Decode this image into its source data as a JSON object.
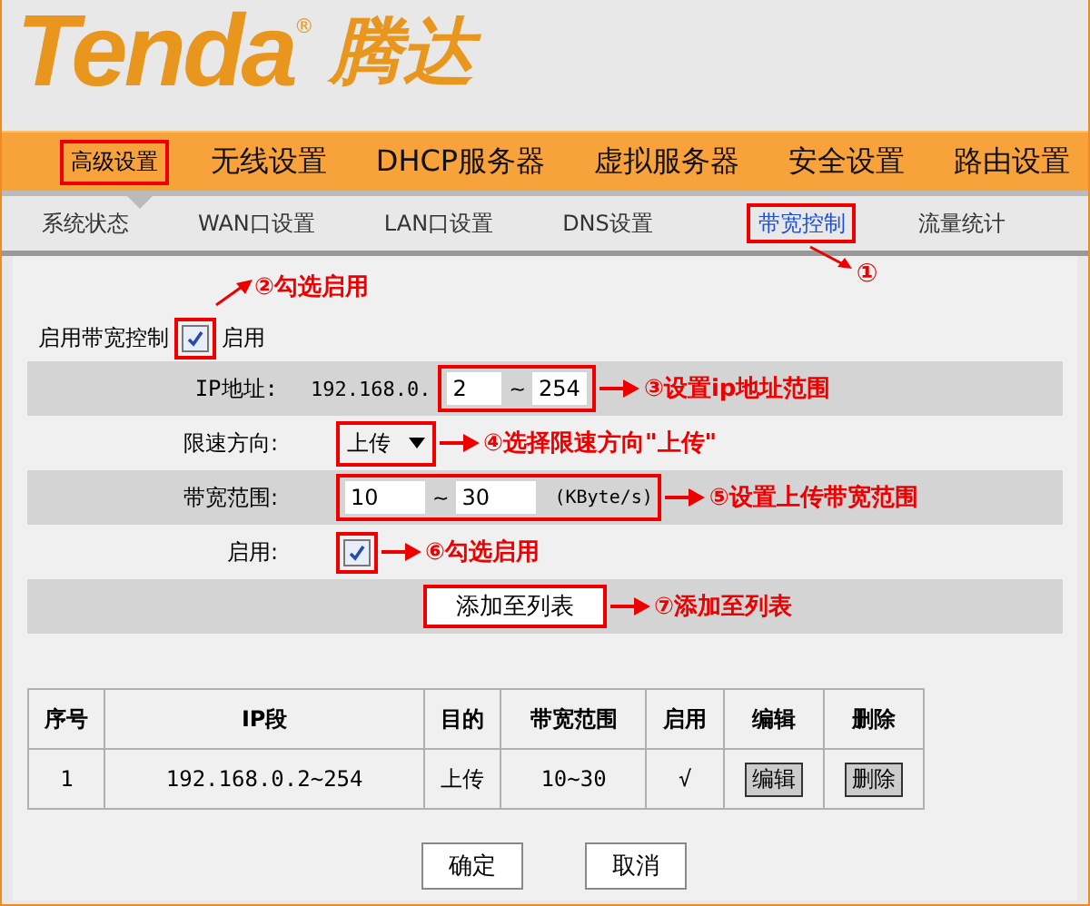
{
  "logo": {
    "brand": "Tenda",
    "mark": "®",
    "cn": "腾达"
  },
  "nav": [
    {
      "label": "高级设置",
      "selected": true,
      "highlight": true
    },
    {
      "label": "无线设置",
      "selected": false,
      "highlight": false
    },
    {
      "label": "DHCP服务器",
      "selected": false,
      "highlight": false
    },
    {
      "label": "虚拟服务器",
      "selected": false,
      "highlight": false
    },
    {
      "label": "安全设置",
      "selected": false,
      "highlight": false
    },
    {
      "label": "路由设置",
      "selected": false,
      "highlight": false
    }
  ],
  "subnav": [
    {
      "label": "系统状态",
      "selected": false,
      "highlight": false
    },
    {
      "label": "WAN口设置",
      "selected": false,
      "highlight": false
    },
    {
      "label": "LAN口设置",
      "selected": false,
      "highlight": false
    },
    {
      "label": "DNS设置",
      "selected": false,
      "highlight": false
    },
    {
      "label": "带宽控制",
      "selected": true,
      "highlight": true,
      "note": "①"
    },
    {
      "label": "流量统计",
      "selected": false,
      "highlight": false
    }
  ],
  "enable_control": {
    "label": "启用带宽控制",
    "checked": true,
    "text": "启用",
    "note": "②勾选启用"
  },
  "form": [
    {
      "kind": "ip",
      "label": "IP地址:",
      "prefix": "192.168.0.",
      "from": "2",
      "sep": "~",
      "to": "254",
      "note": "③设置ip地址范围"
    },
    {
      "kind": "select",
      "label": "限速方向:",
      "value": "上传",
      "note": "④选择限速方向\"上传\""
    },
    {
      "kind": "range",
      "label": "带宽范围:",
      "from": "10",
      "sep": "~",
      "to": "30",
      "unit": "(KByte/s)",
      "note": "⑤设置上传带宽范围"
    },
    {
      "kind": "checkbox",
      "label": "启用:",
      "checked": true,
      "note": "⑥勾选启用"
    },
    {
      "kind": "button",
      "label": "添加至列表",
      "note": "⑦添加至列表"
    }
  ],
  "table": {
    "columns": [
      "序号",
      "IP段",
      "目的",
      "带宽范围",
      "启用",
      "编辑",
      "删除"
    ],
    "rows": [
      {
        "cells": [
          "1",
          "192.168.0.2~254",
          "上传",
          "10~30",
          "√"
        ],
        "edit": "编辑",
        "delete": "删除"
      }
    ]
  },
  "buttons": [
    "确定",
    "取消"
  ]
}
